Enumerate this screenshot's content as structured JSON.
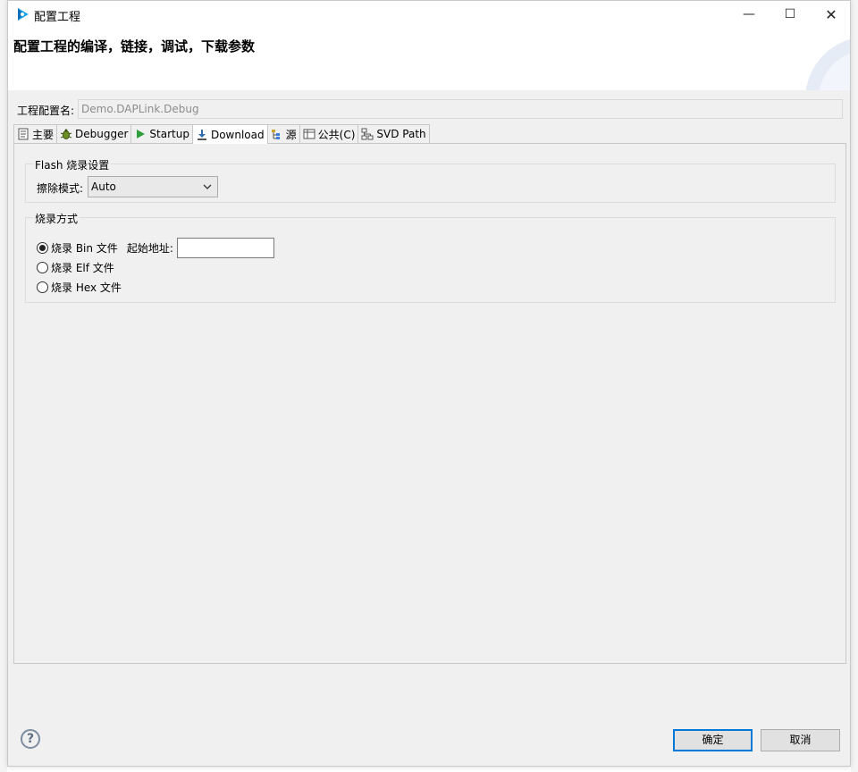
{
  "window": {
    "title": "配置工程",
    "min_glyph": "—",
    "max_glyph": "☐",
    "close_glyph": "✕"
  },
  "header": {
    "title": "配置工程的编译，链接，调试，下载参数"
  },
  "config": {
    "name_label": "工程配置名:",
    "name_value": "Demo.DAPLink.Debug"
  },
  "tabs": [
    {
      "label": "主要",
      "icon": "page-icon"
    },
    {
      "label": "Debugger",
      "icon": "bug-icon"
    },
    {
      "label": "Startup",
      "icon": "play-icon"
    },
    {
      "label": "Download",
      "icon": "download-icon"
    },
    {
      "label": "源",
      "icon": "source-icon"
    },
    {
      "label": "公共(C)",
      "icon": "table-icon"
    },
    {
      "label": "SVD Path",
      "icon": "tree-icon"
    }
  ],
  "flash": {
    "group_label": "Flash 烧录设置",
    "erase_label": "擦除模式:",
    "erase_value": "Auto"
  },
  "burn": {
    "group_label": "烧录方式",
    "bin_label": "烧录 Bin 文件",
    "start_addr_label": "起始地址:",
    "start_addr_value": "",
    "elf_label": "烧录 Elf 文件",
    "hex_label": "烧录 Hex 文件"
  },
  "footer": {
    "help_glyph": "?",
    "ok_label": "确定",
    "cancel_label": "取消"
  },
  "colors": {
    "accent": "#0078d7",
    "tab_active": "#ffffff",
    "dialog_bg": "#f0f0f0"
  }
}
